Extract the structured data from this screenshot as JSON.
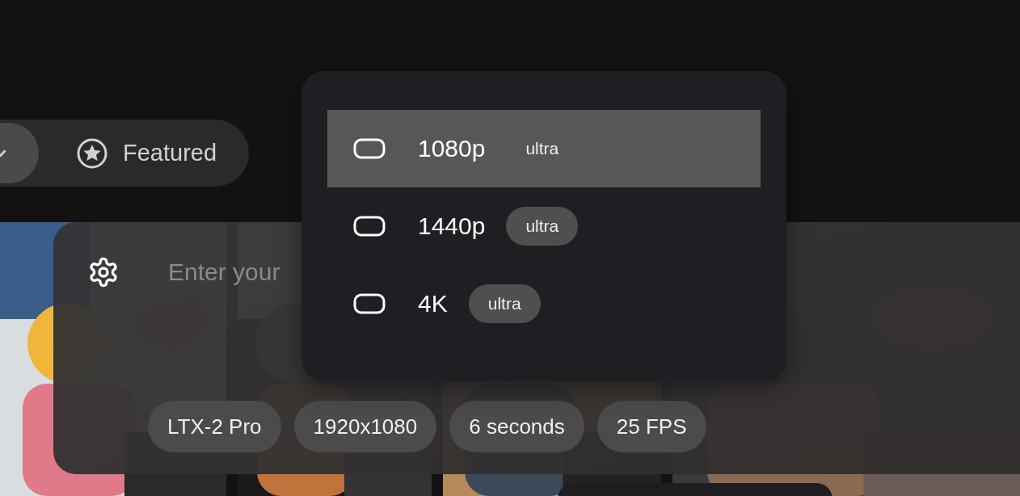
{
  "filters": [
    {
      "kind": "check",
      "selected": true
    },
    {
      "kind": "star",
      "label": "Featured",
      "selected": false
    }
  ],
  "prompt": {
    "placeholder": "Enter your",
    "chips": [
      "LTX-2 Pro",
      "1920x1080",
      "6 seconds",
      "25 FPS"
    ]
  },
  "resolution_menu": {
    "items": [
      {
        "label": "1080p",
        "badge": "ultra",
        "selected": true
      },
      {
        "label": "1440p",
        "badge": "ultra",
        "selected": false
      },
      {
        "label": "4K",
        "badge": "ultra",
        "selected": false
      }
    ]
  }
}
